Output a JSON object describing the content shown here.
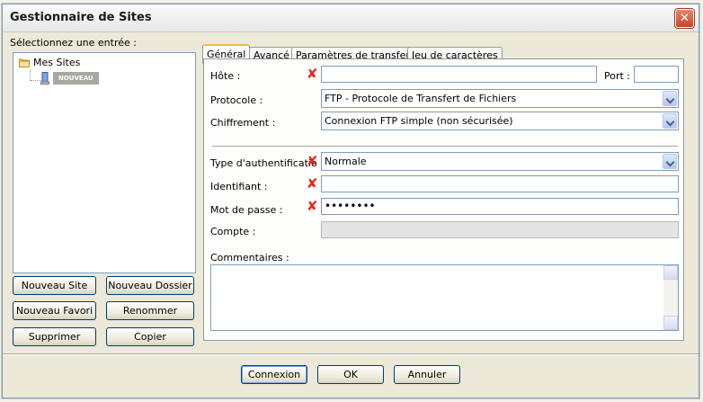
{
  "window": {
    "title": "Gestionnaire de Sites",
    "close_glyph": "✕"
  },
  "left": {
    "select_label": "Sélectionnez une entrée :",
    "tree": {
      "root_label": "Mes Sites",
      "root_icon": "folder-icon",
      "child_label": "NOUVEAU",
      "child_icon": "site-icon"
    },
    "buttons": {
      "new_site": "Nouveau Site",
      "new_folder": "Nouveau Dossier",
      "new_bookmark": "Nouveau Favori",
      "rename": "Renommer",
      "delete": "Supprimer",
      "copy": "Copier"
    }
  },
  "tabs": [
    {
      "label": "Général",
      "active": true
    },
    {
      "label": "Avancé",
      "active": false
    },
    {
      "label": "Paramètres de transfert",
      "active": false
    },
    {
      "label": "Jeu de caractères",
      "active": false
    }
  ],
  "general": {
    "host_label": "Hôte :",
    "host_value": "",
    "port_label": "Port :",
    "port_value": "",
    "protocol_label": "Protocole :",
    "protocol_value": "FTP - Protocole de Transfert de Fichiers",
    "encryption_label": "Chiffrement :",
    "encryption_value": "Connexion FTP simple (non sécurisée)",
    "auth_type_label": "Type d'authentificatio",
    "auth_type_value": "Normale",
    "user_label": "Identifiant :",
    "user_value": "",
    "password_label": "Mot de passe :",
    "password_value": "••••••••",
    "account_label": "Compte :",
    "account_value": "",
    "comments_label": "Commentaires :",
    "error_glyph": "✘"
  },
  "footer": {
    "connect": "Connexion",
    "ok": "OK",
    "cancel": "Annuler"
  },
  "colors": {
    "error": "#e8261a",
    "selection": "#a8a7a2",
    "active_tab_accent": "#f7b64a"
  }
}
